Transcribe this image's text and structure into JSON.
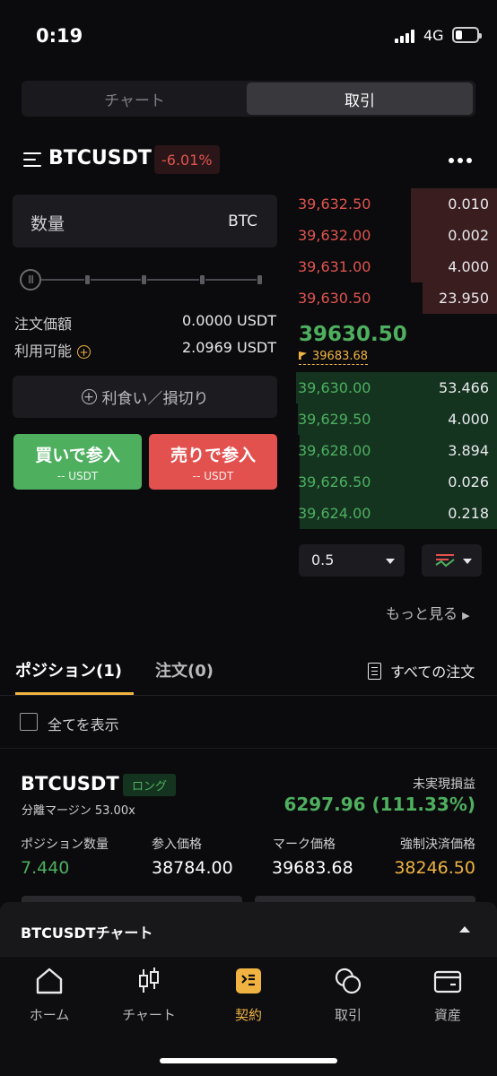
{
  "status": {
    "time": "0:19",
    "network": "4G"
  },
  "segment": {
    "left": "チャート",
    "right": "取引"
  },
  "header": {
    "symbol": "BTCUSDT",
    "change": "-6.01%"
  },
  "order_form": {
    "qty_label": "数量",
    "qty_unit": "BTC",
    "order_value_label": "注文価額",
    "order_value": "0.0000 USDT",
    "available_label": "利用可能",
    "available": "2.0969 USDT",
    "tpsl_label": "利食い／損切り",
    "buy_label": "買いで参入",
    "buy_sub": "-- USDT",
    "sell_label": "売りで参入",
    "sell_sub": "-- USDT"
  },
  "orderbook": {
    "asks": [
      {
        "price": "39,632.50",
        "amount": "0.010",
        "depth": 0.43
      },
      {
        "price": "39,632.00",
        "amount": "0.002",
        "depth": 0.43
      },
      {
        "price": "39,631.00",
        "amount": "4.000",
        "depth": 0.43
      },
      {
        "price": "39,630.50",
        "amount": "23.950",
        "depth": 0.37
      }
    ],
    "last_price": "39630.50",
    "mark_price": "39683.68",
    "bids": [
      {
        "price": "39,630.00",
        "amount": "53.466",
        "depth": 1.0
      },
      {
        "price": "39,629.50",
        "amount": "4.000",
        "depth": 0.99
      },
      {
        "price": "39,628.00",
        "amount": "3.894",
        "depth": 0.98
      },
      {
        "price": "39,626.50",
        "amount": "0.026",
        "depth": 0.98
      },
      {
        "price": "39,624.00",
        "amount": "0.218",
        "depth": 0.98
      }
    ],
    "depth_step": "0.5",
    "see_more": "もっと見る"
  },
  "positions_tabs": {
    "positions": "ポジション(1)",
    "orders": "注文(0)",
    "all_orders": "すべての注文",
    "show_all": "全てを表示"
  },
  "position": {
    "symbol": "BTCUSDT",
    "side": "ロング",
    "margin": "分離マージン 53.00x",
    "pnl_label": "未実現損益",
    "pnl_value": "6297.96 (111.33%)",
    "headers": [
      "ポジション数量",
      "参入価格",
      "マーク価格",
      "強制決済価格"
    ],
    "values": [
      "7.440",
      "38784.00",
      "39683.68",
      "38246.50"
    ]
  },
  "sheet": {
    "title": "BTCUSDTチャート"
  },
  "nav": {
    "items": [
      "ホーム",
      "チャート",
      "契約",
      "取引",
      "資産"
    ],
    "active_index": 2
  },
  "colors": {
    "green": "#4eaf5f",
    "red": "#e3514e",
    "accent": "#f0b341"
  }
}
